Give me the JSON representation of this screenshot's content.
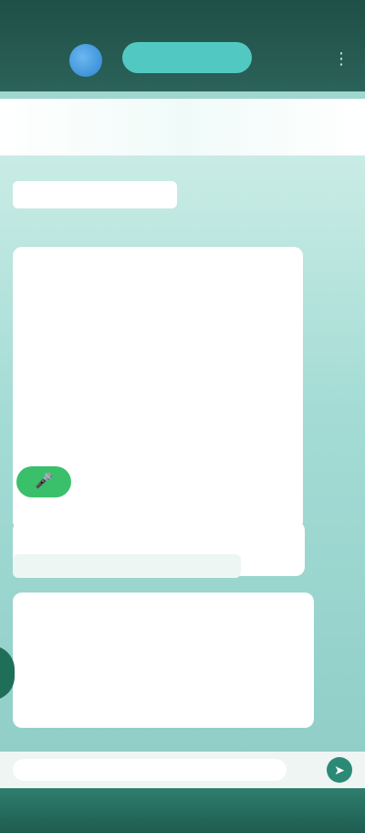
{
  "header": {
    "title": "",
    "menu_icon": "more-vertical-icon"
  },
  "banner": {
    "text": ""
  },
  "chat": {
    "date_label": "",
    "messages": [
      {
        "lines": [
          "",
          "",
          "",
          "",
          "",
          "",
          "",
          "",
          "",
          "",
          "",
          ""
        ]
      },
      {
        "lines": [
          "",
          ""
        ]
      },
      {
        "lines": [
          "",
          "",
          "",
          "",
          "",
          ""
        ]
      }
    ],
    "quoted_text": "",
    "voice_badge_icon": "microphone-icon"
  },
  "composer": {
    "placeholder": "",
    "send_icon": "send-icon"
  },
  "colors": {
    "appbar": "#1f4f47",
    "accent": "#51c9c2",
    "chat_bg": "#a4dcd5",
    "voice_badge": "#3ac06a"
  }
}
